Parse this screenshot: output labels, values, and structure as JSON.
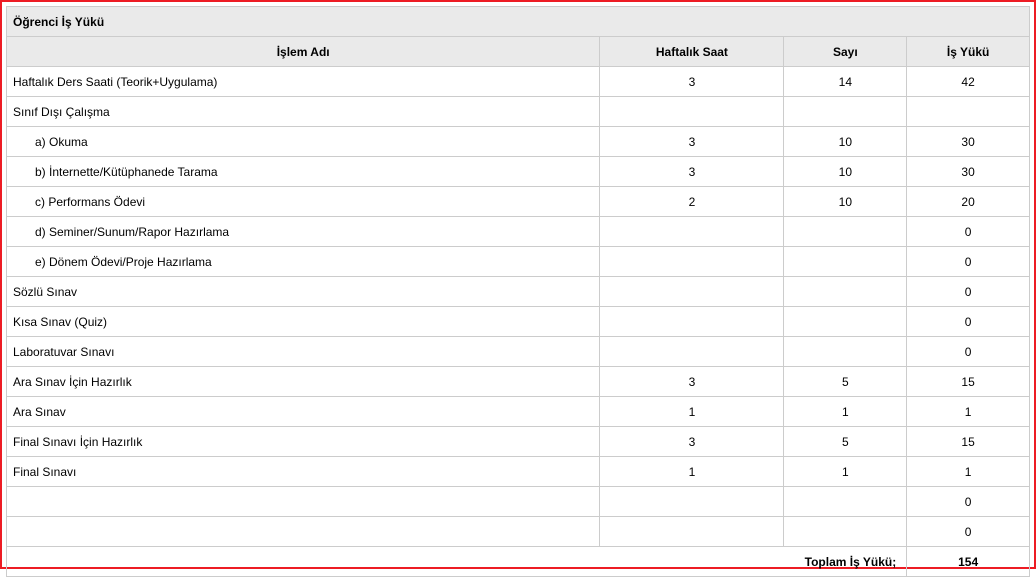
{
  "title": "Öğrenci İş Yükü",
  "headers": {
    "name": "İşlem Adı",
    "hours": "Haftalık Saat",
    "count": "Sayı",
    "load": "İş Yükü"
  },
  "rows": [
    {
      "name": "Haftalık Ders Saati (Teorik+Uygulama)",
      "hours": "3",
      "count": "14",
      "load": "42",
      "indent": false
    },
    {
      "name": "Sınıf Dışı Çalışma",
      "hours": "",
      "count": "",
      "load": "",
      "indent": false
    },
    {
      "name": "a) Okuma",
      "hours": "3",
      "count": "10",
      "load": "30",
      "indent": true
    },
    {
      "name": "b) İnternette/Kütüphanede Tarama",
      "hours": "3",
      "count": "10",
      "load": "30",
      "indent": true
    },
    {
      "name": "c) Performans Ödevi",
      "hours": "2",
      "count": "10",
      "load": "20",
      "indent": true
    },
    {
      "name": "d) Seminer/Sunum/Rapor Hazırlama",
      "hours": "",
      "count": "",
      "load": "0",
      "indent": true
    },
    {
      "name": "e) Dönem Ödevi/Proje Hazırlama",
      "hours": "",
      "count": "",
      "load": "0",
      "indent": true
    },
    {
      "name": "Sözlü Sınav",
      "hours": "",
      "count": "",
      "load": "0",
      "indent": false
    },
    {
      "name": "Kısa Sınav (Quiz)",
      "hours": "",
      "count": "",
      "load": "0",
      "indent": false
    },
    {
      "name": "Laboratuvar Sınavı",
      "hours": "",
      "count": "",
      "load": "0",
      "indent": false
    },
    {
      "name": "Ara Sınav İçin Hazırlık",
      "hours": "3",
      "count": "5",
      "load": "15",
      "indent": false
    },
    {
      "name": "Ara Sınav",
      "hours": "1",
      "count": "1",
      "load": "1",
      "indent": false
    },
    {
      "name": "Final Sınavı İçin Hazırlık",
      "hours": "3",
      "count": "5",
      "load": "15",
      "indent": false
    },
    {
      "name": "Final Sınavı",
      "hours": "1",
      "count": "1",
      "load": "1",
      "indent": false
    },
    {
      "name": "",
      "hours": "",
      "count": "",
      "load": "0",
      "indent": false
    },
    {
      "name": "",
      "hours": "",
      "count": "",
      "load": "0",
      "indent": false
    }
  ],
  "total_label": "Toplam İş Yükü;",
  "total_value": "154"
}
